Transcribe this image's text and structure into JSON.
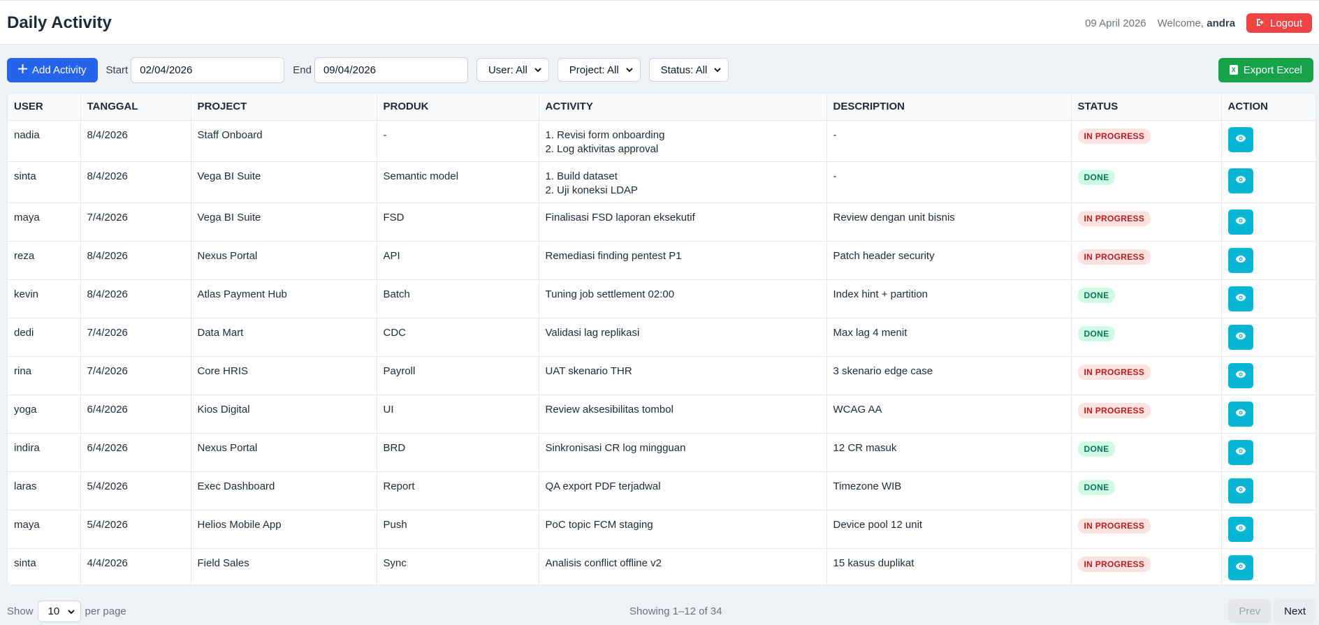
{
  "header": {
    "title": "Daily Activity",
    "date": "09 April 2026",
    "welcome_prefix": "Welcome,",
    "username": "andra",
    "logout_label": "Logout"
  },
  "toolbar": {
    "add_label": "Add Activity",
    "start_label": "Start",
    "start_value": "02/04/2026",
    "end_label": "End",
    "end_value": "09/04/2026",
    "user_filter": "User: All",
    "project_filter": "Project: All",
    "status_filter": "Status: All",
    "export_label": "Export Excel"
  },
  "table": {
    "columns": [
      "USER",
      "TANGGAL",
      "PROJECT",
      "PRODUK",
      "ACTIVITY",
      "DESCRIPTION",
      "STATUS",
      "ACTION"
    ],
    "rows": [
      {
        "user": "nadia",
        "tanggal": "8/4/2026",
        "project": "Staff Onboard",
        "produk": "-",
        "activity": [
          "1. Revisi form onboarding",
          "2. Log aktivitas approval"
        ],
        "description": "-",
        "status": "IN PROGRESS"
      },
      {
        "user": "sinta",
        "tanggal": "8/4/2026",
        "project": "Vega BI Suite",
        "produk": "Semantic model",
        "activity": [
          "1. Build dataset",
          "2. Uji koneksi LDAP"
        ],
        "description": "-",
        "status": "DONE"
      },
      {
        "user": "maya",
        "tanggal": "7/4/2026",
        "project": "Vega BI Suite",
        "produk": "FSD",
        "activity": [
          "Finalisasi FSD laporan eksekutif"
        ],
        "description": "Review dengan unit bisnis",
        "status": "IN PROGRESS"
      },
      {
        "user": "reza",
        "tanggal": "8/4/2026",
        "project": "Nexus Portal",
        "produk": "API",
        "activity": [
          "Remediasi finding pentest P1"
        ],
        "description": "Patch header security",
        "status": "IN PROGRESS"
      },
      {
        "user": "kevin",
        "tanggal": "8/4/2026",
        "project": "Atlas Payment Hub",
        "produk": "Batch",
        "activity": [
          "Tuning job settlement 02:00"
        ],
        "description": "Index hint + partition",
        "status": "DONE"
      },
      {
        "user": "dedi",
        "tanggal": "7/4/2026",
        "project": "Data Mart",
        "produk": "CDC",
        "activity": [
          "Validasi lag replikasi"
        ],
        "description": "Max lag 4 menit",
        "status": "DONE"
      },
      {
        "user": "rina",
        "tanggal": "7/4/2026",
        "project": "Core HRIS",
        "produk": "Payroll",
        "activity": [
          "UAT skenario THR"
        ],
        "description": "3 skenario edge case",
        "status": "IN PROGRESS"
      },
      {
        "user": "yoga",
        "tanggal": "6/4/2026",
        "project": "Kios Digital",
        "produk": "UI",
        "activity": [
          "Review aksesibilitas tombol"
        ],
        "description": "WCAG AA",
        "status": "IN PROGRESS"
      },
      {
        "user": "indira",
        "tanggal": "6/4/2026",
        "project": "Nexus Portal",
        "produk": "BRD",
        "activity": [
          "Sinkronisasi CR log mingguan"
        ],
        "description": "12 CR masuk",
        "status": "DONE"
      },
      {
        "user": "laras",
        "tanggal": "5/4/2026",
        "project": "Exec Dashboard",
        "produk": "Report",
        "activity": [
          "QA export PDF terjadwal"
        ],
        "description": "Timezone WIB",
        "status": "DONE"
      },
      {
        "user": "maya",
        "tanggal": "5/4/2026",
        "project": "Helios Mobile App",
        "produk": "Push",
        "activity": [
          "PoC topic FCM staging"
        ],
        "description": "Device pool 12 unit",
        "status": "IN PROGRESS"
      },
      {
        "user": "sinta",
        "tanggal": "4/4/2026",
        "project": "Field Sales",
        "produk": "Sync",
        "activity": [
          "Analisis conflict offline v2"
        ],
        "description": "15 kasus duplikat",
        "status": "IN PROGRESS"
      }
    ]
  },
  "footer": {
    "show_label": "Show",
    "per_page_value": "10",
    "per_page_label": "per page",
    "showing": "Showing 1–12 of 34",
    "prev_label": "Prev",
    "next_label": "Next"
  },
  "colors": {
    "primary": "#2563eb",
    "danger": "#ef4444",
    "success": "#16a34a",
    "info": "#06b6d4"
  },
  "icons": {
    "add": "plus-icon",
    "logout": "logout-icon",
    "export": "excel-icon",
    "view": "eye-icon",
    "dropdown": "chevron-down-icon"
  }
}
